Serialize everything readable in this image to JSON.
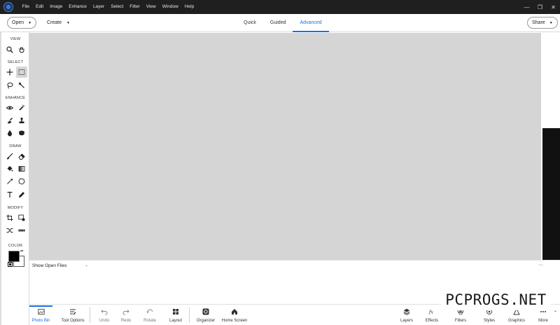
{
  "menu": [
    "File",
    "Edit",
    "Image",
    "Enhance",
    "Layer",
    "Select",
    "Filter",
    "View",
    "Window",
    "Help"
  ],
  "window_controls": {
    "minimize": "—",
    "restore": "❐",
    "close": "✕"
  },
  "topbar": {
    "open_label": "Open",
    "create_label": "Create",
    "modes": [
      "Quick",
      "Guided",
      "Advanced"
    ],
    "active_mode": "Advanced",
    "share_label": "Share"
  },
  "toolbar": {
    "sections": {
      "view": "VIEW",
      "select": "SELECT",
      "enhance": "ENHANCE",
      "draw": "DRAW",
      "modify": "MODIFY",
      "color": "COLOR"
    }
  },
  "colors": {
    "foreground": "#000000",
    "background": "#ffffff",
    "accent": "#1473e6"
  },
  "bin": {
    "show_label": "Show Open Files"
  },
  "taskbar": {
    "photo_bin": "Photo Bin",
    "tool_options": "Tool Options",
    "undo": "Undo",
    "redo": "Redo",
    "rotate": "Rotate",
    "layout": "Layout",
    "organizer": "Organizer",
    "home_screen": "Home Screen",
    "layers": "Layers",
    "effects": "Effects",
    "filters": "Filters",
    "styles": "Styles",
    "graphics": "Graphics",
    "more": "More"
  },
  "watermark": "PCPROGS.NET"
}
